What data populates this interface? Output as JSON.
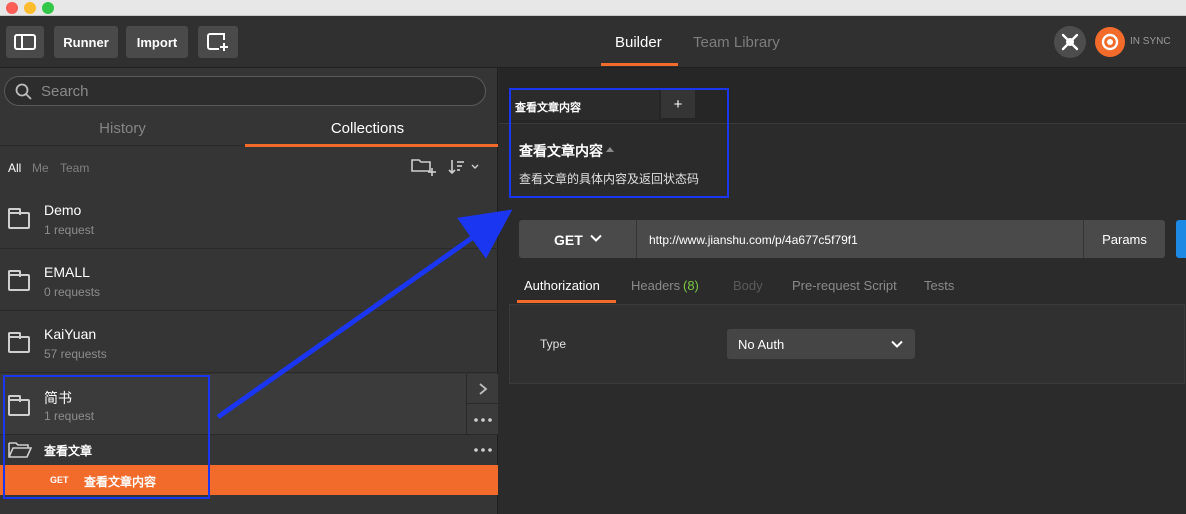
{
  "toolbar": {
    "runner_label": "Runner",
    "import_label": "Import",
    "builder_label": "Builder",
    "team_library_label": "Team Library",
    "sync_label": "IN SYNC"
  },
  "sidebar": {
    "search_placeholder": "Search",
    "tabs": {
      "history": "History",
      "collections": "Collections"
    },
    "filters": {
      "all": "All",
      "me": "Me",
      "team": "Team"
    },
    "collections": [
      {
        "name": "Demo",
        "count": "1 request"
      },
      {
        "name": "EMALL",
        "count": "0 requests"
      },
      {
        "name": "KaiYuan",
        "count": "57 requests"
      },
      {
        "name": "简书",
        "count": "1 request"
      }
    ],
    "folder": {
      "name": "查看文章"
    },
    "request": {
      "method": "GET",
      "name": "查看文章内容"
    }
  },
  "main": {
    "tab_title": "查看文章内容",
    "add_tab": "+",
    "request_title": "查看文章内容",
    "request_description": "查看文章的具体内容及返回状态码",
    "method": "GET",
    "url": "http://www.jianshu.com/p/4a677c5f79f1",
    "params_label": "Params",
    "req_tabs": {
      "authorization": "Authorization",
      "headers": "Headers",
      "headers_count": "(8)",
      "body": "Body",
      "pre_request": "Pre-request Script",
      "tests": "Tests"
    },
    "auth": {
      "type_label": "Type",
      "type_value": "No Auth"
    }
  },
  "colors": {
    "accent_orange": "#f26b2a",
    "annotation_blue": "#1b36f0",
    "headers_count_green": "#7ac943"
  }
}
